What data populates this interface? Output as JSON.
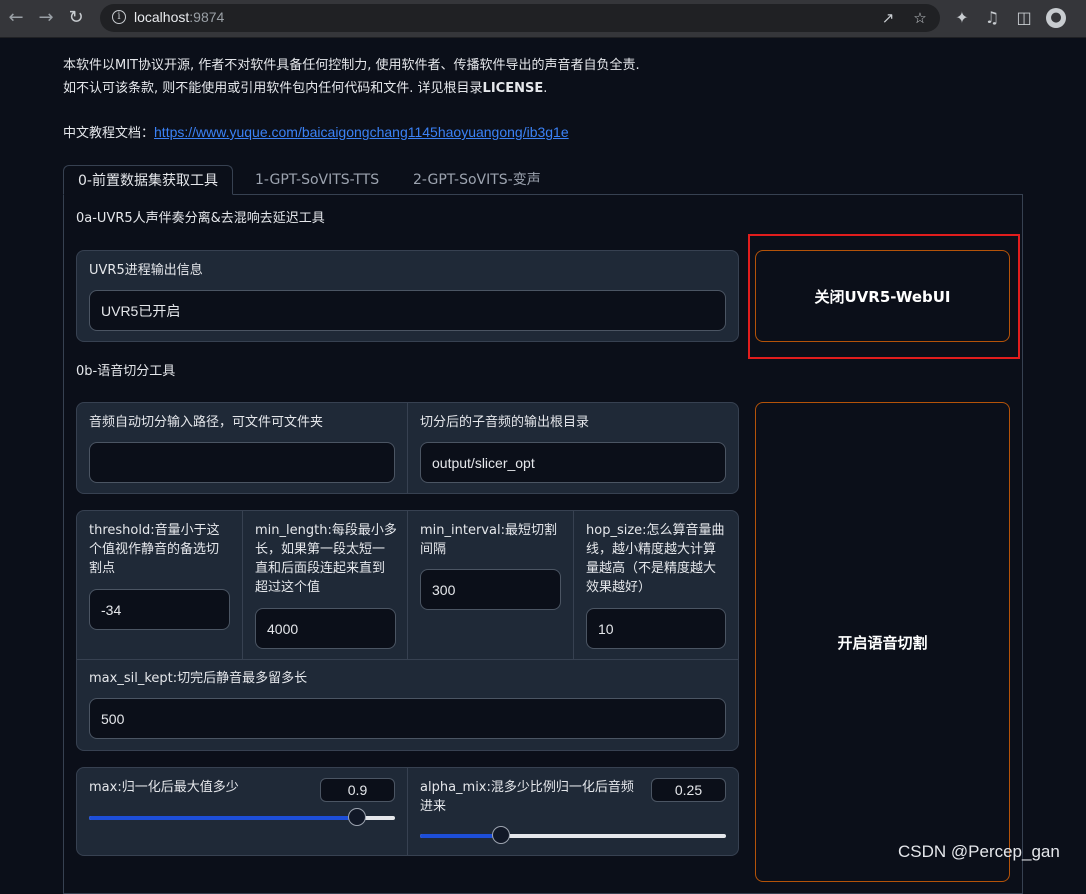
{
  "browser": {
    "host": "localhost",
    "port": ":9874"
  },
  "notice": {
    "line1": "本软件以MIT协议开源, 作者不对软件具备任何控制力, 使用软件者、传播软件导出的声音者自负全责.",
    "line2_prefix": "如不认可该条款, 则不能使用或引用软件包内任何代码和文件. 详见根目录",
    "line2_bold": "LICENSE",
    "line2_suffix": ".",
    "doc_label": "中文教程文档：",
    "doc_link": "https://www.yuque.com/baicaigongchang1145haoyuangong/ib3g1e"
  },
  "tabs": [
    {
      "label": "0-前置数据集获取工具"
    },
    {
      "label": "1-GPT-SoVITS-TTS"
    },
    {
      "label": "2-GPT-SoVITS-变声"
    }
  ],
  "uvr5": {
    "section_title": "0a-UVR5人声伴奏分离&去混响去延迟工具",
    "info_label": "UVR5进程输出信息",
    "info_value": "UVR5已开启",
    "button_label": "关闭UVR5-WebUI"
  },
  "slicer": {
    "section_title": "0b-语音切分工具",
    "input_path_label": "音频自动切分输入路径，可文件可文件夹",
    "input_path_value": "",
    "output_dir_label": "切分后的子音频的输出根目录",
    "output_dir_value": "output/slicer_opt",
    "threshold_label": "threshold:音量小于这个值视作静音的备选切割点",
    "threshold_value": "-34",
    "min_length_label": "min_length:每段最小多长，如果第一段太短一直和后面段连起来直到超过这个值",
    "min_length_value": "4000",
    "min_interval_label": "min_interval:最短切割间隔",
    "min_interval_value": "300",
    "hop_size_label": "hop_size:怎么算音量曲线，越小精度越大计算量越高（不是精度越大效果越好）",
    "hop_size_value": "10",
    "max_sil_kept_label": "max_sil_kept:切完后静音最多留多长",
    "max_sil_kept_value": "500",
    "max_label": "max:归一化后最大值多少",
    "max_value": "0.9",
    "max_fraction": 0.9,
    "alpha_label": "alpha_mix:混多少比例归一化后音频进来",
    "alpha_value": "0.25",
    "alpha_fraction": 0.25,
    "button_label": "开启语音切割"
  },
  "watermark": "CSDN @Percep_gan",
  "colors": {
    "background": "#0b0f19",
    "block": "#1f2937",
    "accent_border": "#b45309",
    "slider_fill": "#1d4ed8",
    "highlight": "#e11d1d",
    "link": "#3b82f6"
  }
}
